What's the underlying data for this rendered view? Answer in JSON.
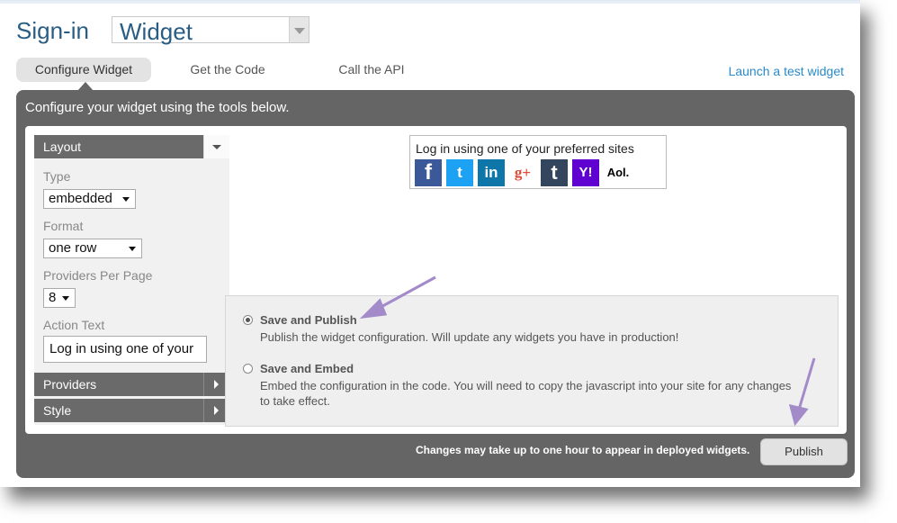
{
  "header": {
    "title": "Sign-in",
    "widget_select": "Widget"
  },
  "tabs": [
    {
      "label": "Configure Widget",
      "active": true
    },
    {
      "label": "Get the Code",
      "active": false
    },
    {
      "label": "Call the API",
      "active": false
    }
  ],
  "launch_link": "Launch a test widget",
  "panel": {
    "heading": "Configure your widget using the tools below."
  },
  "sidebar": {
    "layout_label": "Layout",
    "type_label": "Type",
    "type_value": "embedded",
    "format_label": "Format",
    "format_value": "one row",
    "providers_per_page_label": "Providers Per Page",
    "providers_per_page_value": "8",
    "action_text_label": "Action Text",
    "action_text_value": "Log in using one of your",
    "providers_label": "Providers",
    "style_label": "Style"
  },
  "preview": {
    "prompt": "Log in using one of your preferred sites",
    "providers": [
      {
        "name": "facebook-icon",
        "glyph": "f",
        "color": "#3b5998"
      },
      {
        "name": "twitter-icon",
        "glyph": "t",
        "color": "#1da1f2"
      },
      {
        "name": "linkedin-icon",
        "glyph": "in",
        "color": "#0e76a8"
      },
      {
        "name": "googleplus-icon",
        "glyph": "g+",
        "color": "#dd4b39"
      },
      {
        "name": "tumblr-icon",
        "glyph": "t",
        "color": "#34465d"
      },
      {
        "name": "yahoo-icon",
        "glyph": "Y!",
        "color": "#5f01d1"
      },
      {
        "name": "aol-icon",
        "glyph": "Aol.",
        "color": "#000000"
      }
    ]
  },
  "save_options": [
    {
      "title": "Save and Publish",
      "description": "Publish the widget configuration. Will update any widgets you have in production!",
      "selected": true
    },
    {
      "title": "Save and Embed",
      "description": "Embed the configuration in the code. You will need to copy the javascript into your site for any changes to take effect.",
      "selected": false
    }
  ],
  "footer": {
    "note": "Changes may take up to one hour to appear in deployed widgets.",
    "publish_label": "Publish"
  },
  "colors": {
    "accent": "#2a5d84",
    "link": "#2a8ac7",
    "panel": "#656565",
    "annotation_arrow": "#a38ac9"
  }
}
